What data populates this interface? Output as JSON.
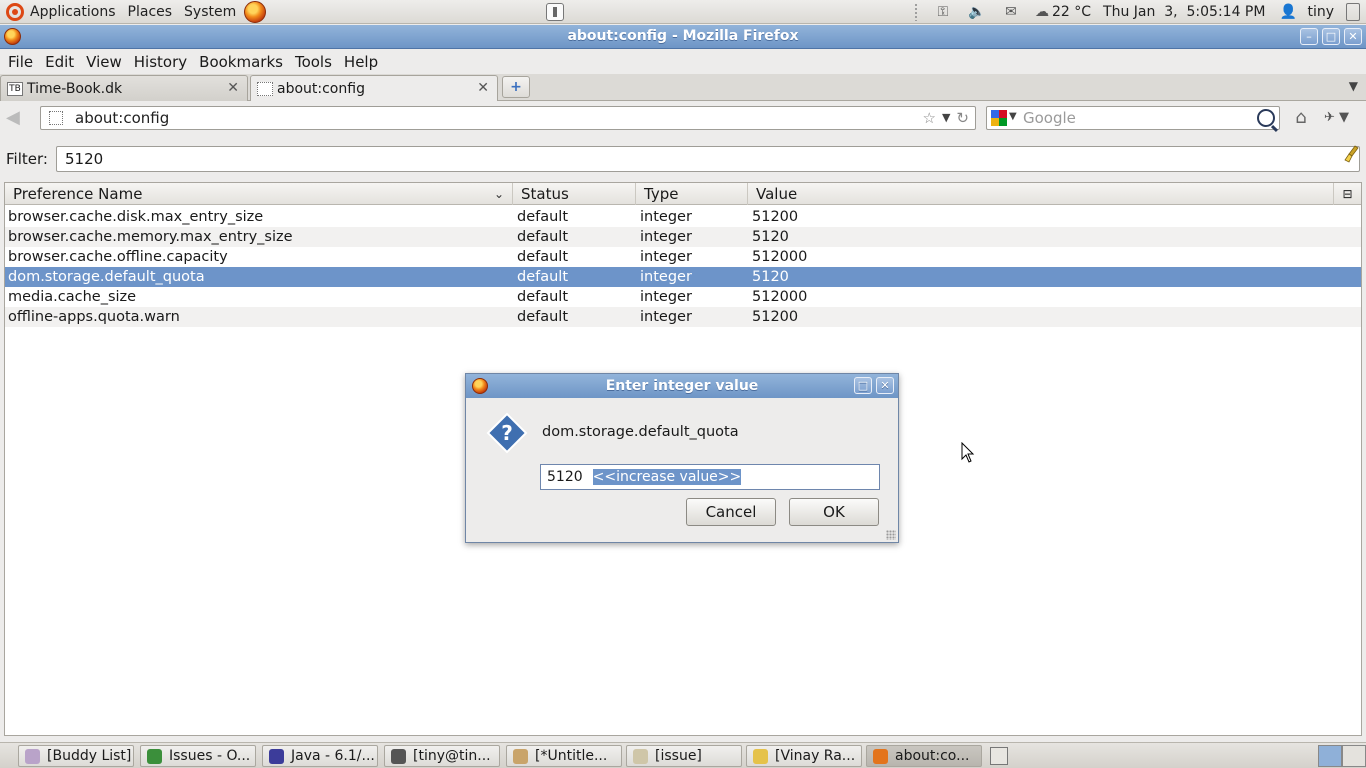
{
  "top_panel": {
    "menus": [
      "Applications",
      "Places",
      "System"
    ],
    "temperature": "22 °C",
    "datetime": "Thu Jan  3,  5:05:14 PM",
    "user": "tiny"
  },
  "window": {
    "title": "about:config - Mozilla Firefox"
  },
  "menubar": [
    "File",
    "Edit",
    "View",
    "History",
    "Bookmarks",
    "Tools",
    "Help"
  ],
  "tabs": [
    {
      "label": "Time-Book.dk",
      "favicon": "TB",
      "active": false
    },
    {
      "label": "about:config",
      "favicon": "",
      "active": true
    }
  ],
  "navbar": {
    "url": "about:config",
    "search_placeholder": "Google"
  },
  "filter": {
    "label": "Filter:",
    "value": "5120"
  },
  "table": {
    "columns": [
      "Preference Name",
      "Status",
      "Type",
      "Value"
    ],
    "rows": [
      {
        "name": "browser.cache.disk.max_entry_size",
        "status": "default",
        "type": "integer",
        "value": "51200"
      },
      {
        "name": "browser.cache.memory.max_entry_size",
        "status": "default",
        "type": "integer",
        "value": "5120"
      },
      {
        "name": "browser.cache.offline.capacity",
        "status": "default",
        "type": "integer",
        "value": "512000"
      },
      {
        "name": "dom.storage.default_quota",
        "status": "default",
        "type": "integer",
        "value": "5120"
      },
      {
        "name": "media.cache_size",
        "status": "default",
        "type": "integer",
        "value": "512000"
      },
      {
        "name": "offline-apps.quota.warn",
        "status": "default",
        "type": "integer",
        "value": "51200"
      }
    ],
    "selected_row": 3
  },
  "dialog": {
    "title": "Enter integer value",
    "message": "dom.storage.default_quota",
    "input_value": "5120",
    "input_selection": "<<increase value>>",
    "cancel_label": "Cancel",
    "ok_label": "OK"
  },
  "taskbar": [
    {
      "label": "[Buddy List]",
      "icon_color": "#b9a3c9"
    },
    {
      "label": "Issues - O...",
      "icon_color": "#3b8f3b"
    },
    {
      "label": "Java - 6.1/...",
      "icon_color": "#3c3c9a"
    },
    {
      "label": "[tiny@tin...",
      "icon_color": "#555555"
    },
    {
      "label": "[*Untitle...",
      "icon_color": "#c9a46a"
    },
    {
      "label": "[issue]",
      "icon_color": "#cfc6a8"
    },
    {
      "label": "[Vinay Ra...",
      "icon_color": "#e5c24a"
    },
    {
      "label": "about:co...",
      "icon_color": "#e3741c"
    }
  ],
  "colors": {
    "title_bar": "#6e95c6",
    "selection": "#6d94c9"
  }
}
